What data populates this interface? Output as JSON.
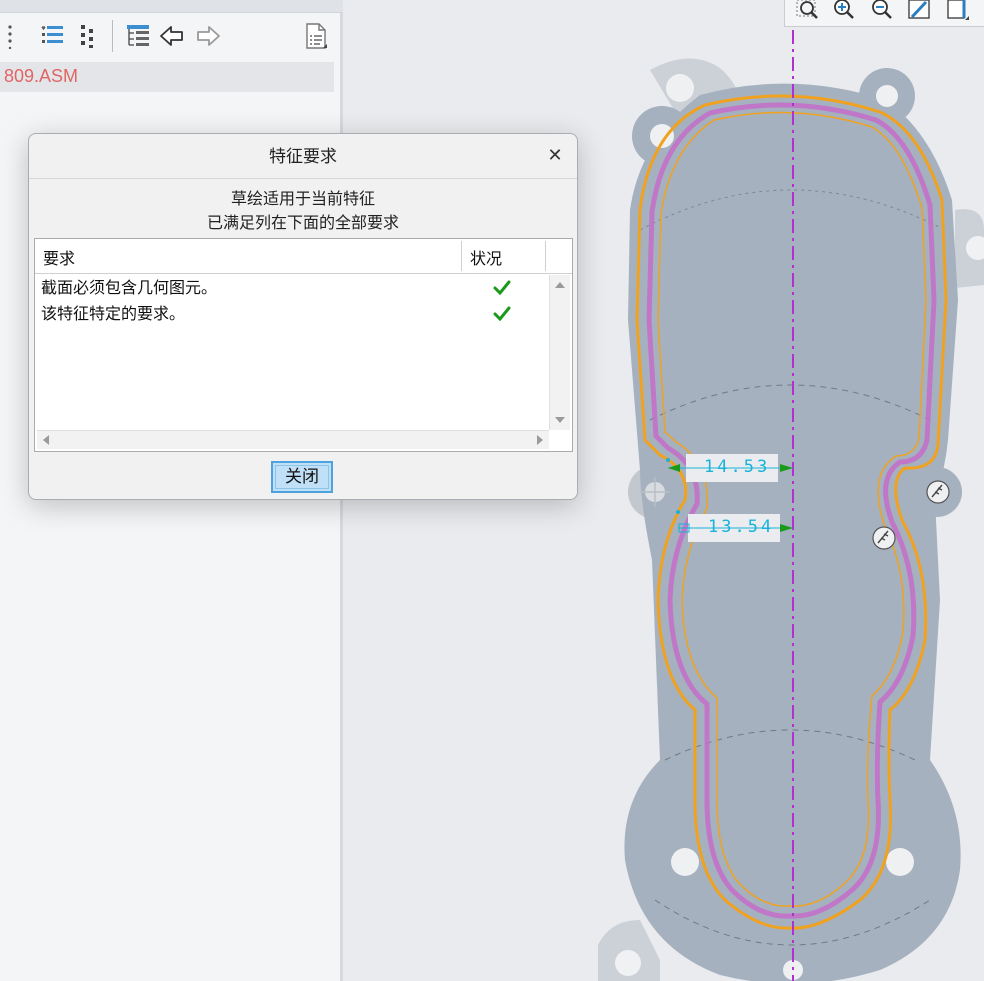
{
  "model_tree": {
    "assembly_name": "809.ASM"
  },
  "dialog": {
    "title": "特征要求",
    "close_glyph": "✕",
    "message_line1": "草绘适用于当前特征",
    "message_line2": "已满足列在下面的全部要求",
    "columns": [
      "要求",
      "状况"
    ],
    "rows": [
      {
        "requirement": "截面必须包含几何图元。",
        "status": "satisfied"
      },
      {
        "requirement": "该特征特定的要求。",
        "status": "satisfied"
      }
    ],
    "close_button_label": "关闭"
  },
  "sketch": {
    "dimensions": [
      "14.53",
      "13.54"
    ]
  },
  "colors": {
    "accent": "#4ea3df",
    "check": "#1a9a1a",
    "part_fill": "#a6b1bf",
    "profile_orange": "#f0a21e",
    "profile_magenta": "#c46dc9",
    "centerline": "#b030d0",
    "dimension_text": "#19b3d9",
    "asm_text": "#e26565"
  },
  "icons": {
    "toolbar": [
      "drag-handle-icon",
      "tree-filter-icon",
      "tree-expand-icon",
      "show-tree-icon",
      "back-arrow-icon",
      "forward-arrow-icon",
      "properties-icon"
    ],
    "view": [
      "zoom-window-icon",
      "zoom-in-icon",
      "zoom-out-icon",
      "sketch-edit-icon",
      "display-style-icon"
    ]
  }
}
